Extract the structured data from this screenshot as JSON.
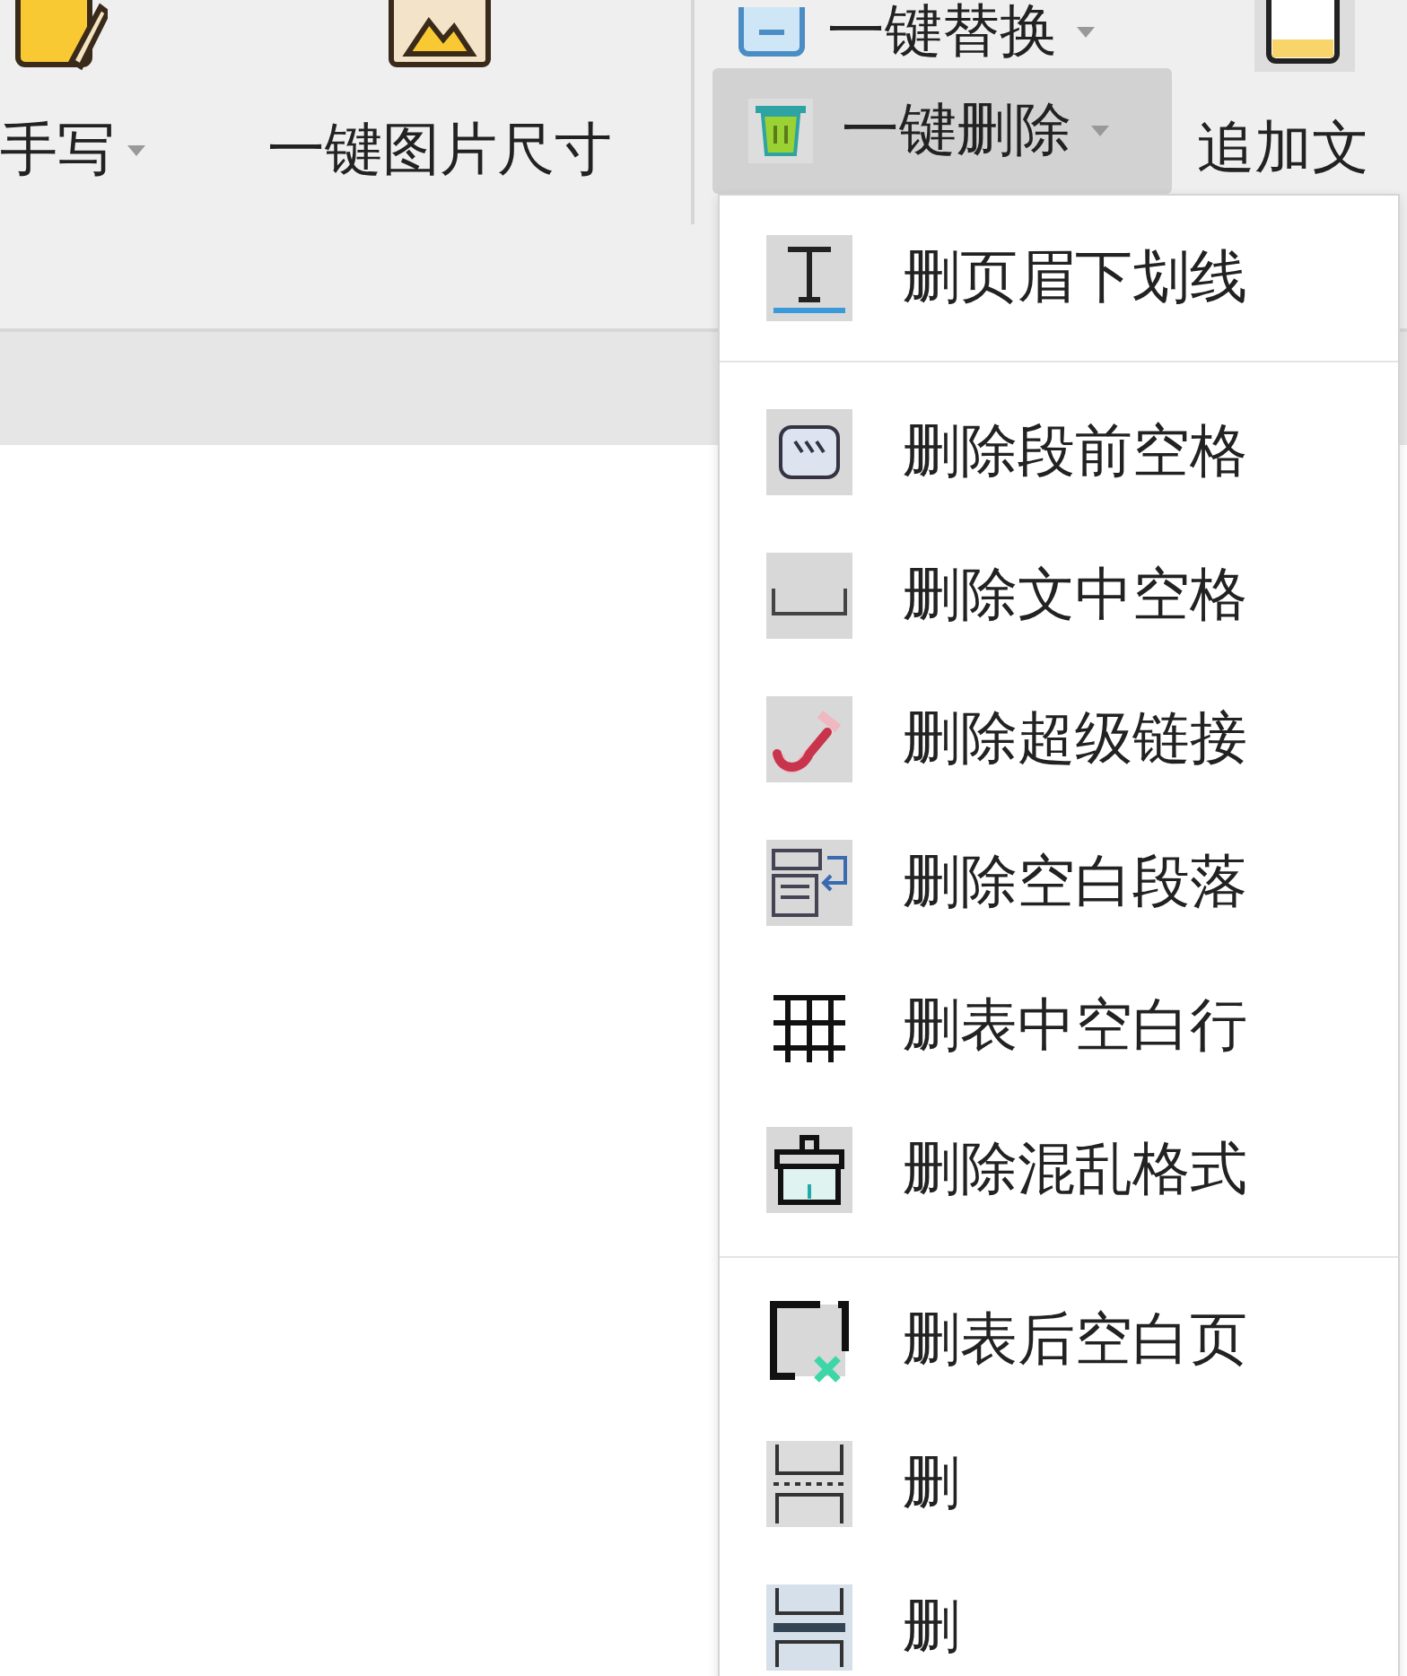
{
  "toolbar": {
    "left_items": [
      {
        "label": "手写",
        "caret": true
      },
      {
        "label": "一键图片尺寸",
        "caret": false
      }
    ],
    "right_column": [
      {
        "label": "一键替换",
        "caret": true,
        "pressed": false
      },
      {
        "label": "一键删除",
        "caret": true,
        "pressed": true
      }
    ],
    "far_right": {
      "label": "追加文"
    }
  },
  "menu": {
    "groups": [
      {
        "items": [
          {
            "label": "删页眉下划线"
          }
        ]
      },
      {
        "items": [
          {
            "label": "删除段前空格"
          },
          {
            "label": "删除文中空格"
          },
          {
            "label": "删除超级链接"
          },
          {
            "label": "删除空白段落"
          },
          {
            "label": "删表中空白行"
          },
          {
            "label": "删除混乱格式"
          }
        ]
      },
      {
        "items": [
          {
            "label": "删表后空白页"
          },
          {
            "label": "删"
          },
          {
            "label": "删"
          }
        ]
      }
    ]
  }
}
